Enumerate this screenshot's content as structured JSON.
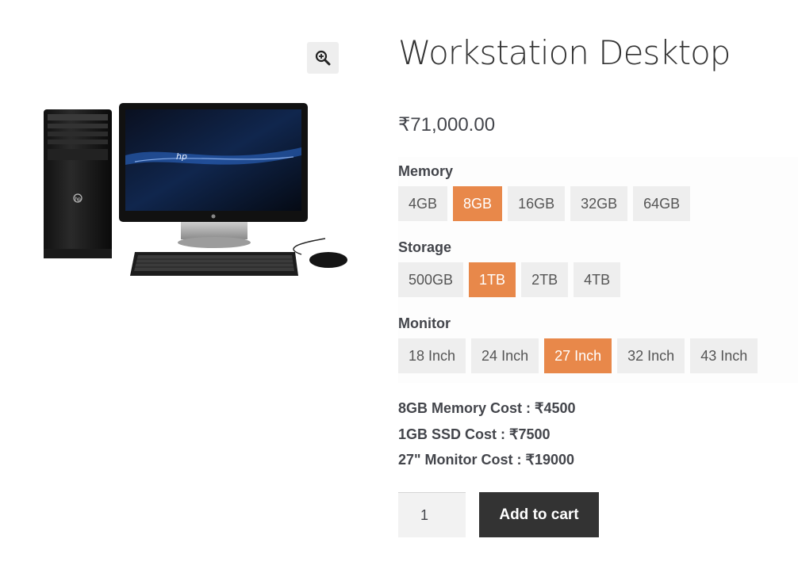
{
  "product": {
    "title": "Workstation Desktop",
    "price": "₹71,000.00",
    "image_alt": "HP desktop computer with tower, monitor, keyboard and mouse",
    "image_brand": "hp"
  },
  "zoom": {
    "icon": "magnifier-zoom-icon"
  },
  "variations": {
    "memory": {
      "label": "Memory",
      "options": [
        "4GB",
        "8GB",
        "16GB",
        "32GB",
        "64GB"
      ],
      "selected": "8GB"
    },
    "storage": {
      "label": "Storage",
      "options": [
        "500GB",
        "1TB",
        "2TB",
        "4TB"
      ],
      "selected": "1TB"
    },
    "monitor": {
      "label": "Monitor",
      "options": [
        "18 Inch",
        "24 Inch",
        "27 Inch",
        "32 Inch",
        "43 Inch"
      ],
      "selected": "27 Inch"
    }
  },
  "costs": [
    "8GB Memory Cost : ₹4500",
    "1GB SSD Cost : ₹7500",
    "27\" Monitor Cost : ₹19000"
  ],
  "cart": {
    "quantity": "1",
    "add_label": "Add to cart"
  },
  "colors": {
    "selected_swatch": "#e8884a",
    "swatch_bg": "#eeeeee",
    "cart_button": "#333333"
  }
}
